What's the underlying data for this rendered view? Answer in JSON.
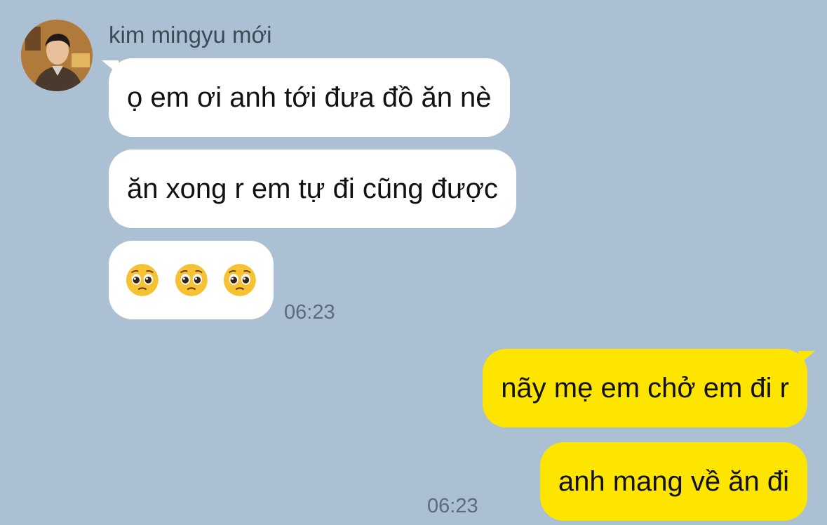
{
  "incoming": {
    "sender_name": "kim mingyu mới",
    "messages": [
      "ọ em ơi anh tới đưa đồ ăn nè",
      "ăn xong r em tự đi cũng được"
    ],
    "emoji_message": [
      "🥺",
      "🥺",
      "🥺"
    ],
    "time": "06:23"
  },
  "outgoing": {
    "messages": [
      "nãy mẹ em chở em đi r",
      "anh mang về ăn đi"
    ],
    "time": "06:23"
  },
  "colors": {
    "background": "#abc1d3",
    "incoming_bubble": "#ffffff",
    "outgoing_bubble": "#fee500"
  }
}
